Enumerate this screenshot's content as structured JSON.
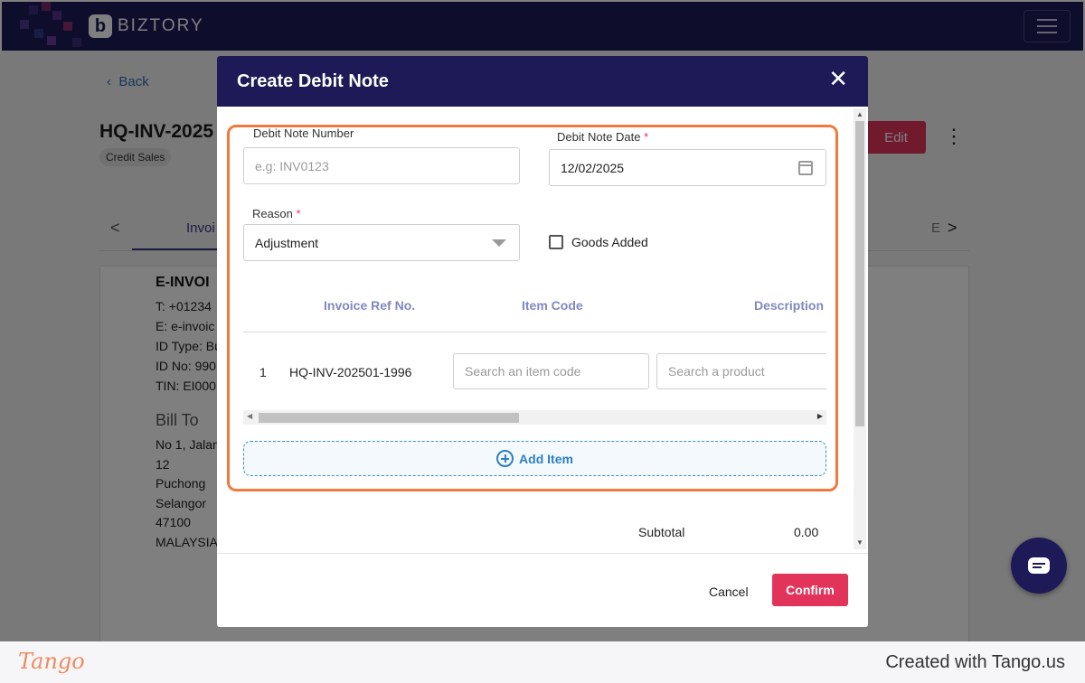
{
  "app": {
    "brand_mark": "b",
    "brand_name": "BIZTORY"
  },
  "page": {
    "back_label": "Back",
    "invoice_title": "HQ-INV-2025",
    "chip_label": "Credit Sales",
    "edit_label": "Edit",
    "kebab": "⋮",
    "tab_prev": "<",
    "tab_next": ">",
    "tab_invoice": "Invoi",
    "tab_right": "E",
    "einvoice_title": "E-INVOI",
    "einvoice_lines": [
      "T: +01234",
      "E: e-invoic",
      "ID Type: Bu",
      "ID No: 990",
      "TIN: EI000"
    ],
    "bill_to": "Bill To",
    "bill_lines": [
      "No 1, Jalan",
      "12",
      "Puchong",
      "Selangor",
      "47100",
      "MALAYSIA"
    ]
  },
  "modal": {
    "title": "Create Debit Note",
    "close": "✕",
    "debit_note_number": {
      "label": "Debit Note Number",
      "placeholder": "e.g: INV0123"
    },
    "debit_note_date": {
      "label": "Debit Note Date",
      "required_mark": "*",
      "value": "12/02/2025"
    },
    "reason": {
      "label": "Reason",
      "required_mark": "*",
      "value": "Adjustment"
    },
    "goods_added": {
      "label": "Goods Added",
      "checked": false
    },
    "table": {
      "headers": [
        "Invoice Ref No.",
        "Item Code",
        "Description"
      ],
      "rows": [
        {
          "index": "1",
          "invoice_ref": "HQ-INV-202501-1996",
          "item_code_placeholder": "Search an item code",
          "product_placeholder": "Search a product"
        }
      ]
    },
    "add_item_label": "Add Item",
    "subtotal": {
      "label": "Subtotal",
      "value": "0.00"
    },
    "cancel_label": "Cancel",
    "confirm_label": "Confirm"
  },
  "footer": {
    "logo": "Tango",
    "created_with": "Created with Tango.us"
  },
  "colors": {
    "navy": "#1e1a58",
    "accent_red": "#e2335b",
    "highlight_orange": "#f07a3e",
    "link_blue": "#2f6fb0",
    "add_item_blue": "#2d7fc1"
  }
}
